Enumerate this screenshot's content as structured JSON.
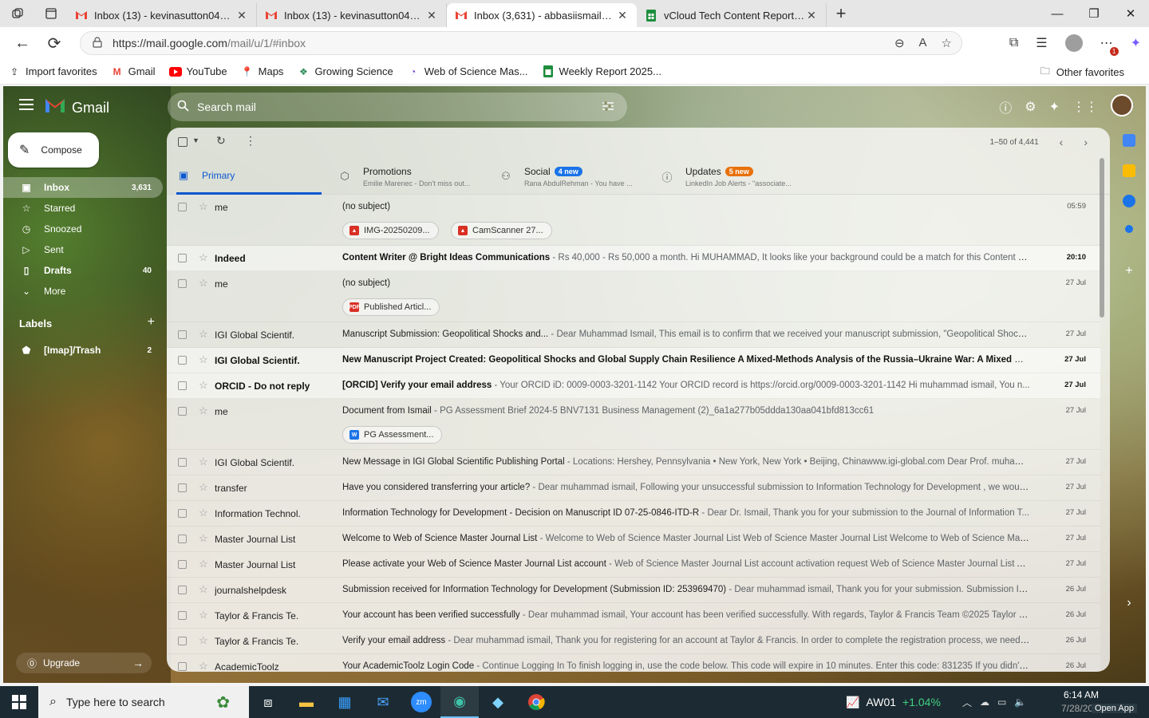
{
  "browser": {
    "tabs": [
      {
        "title": "Inbox (13) - kevinasutton04@gmail.com",
        "active": false
      },
      {
        "title": "Inbox (13) - kevinasutton04@gmail.com",
        "active": false
      },
      {
        "title": "Inbox (3,631) - abbasiismail08@gmail.com",
        "active": true
      },
      {
        "title": "vCloud Tech Content Report - Google Sheets",
        "active": false
      }
    ],
    "url_host": "https://mail.google.com",
    "url_path": "/mail/u/1/#inbox",
    "favorites": [
      {
        "label": "Import favorites",
        "icon": "import-icon"
      },
      {
        "label": "Gmail",
        "icon": "gmail-icon"
      },
      {
        "label": "YouTube",
        "icon": "youtube-icon"
      },
      {
        "label": "Maps",
        "icon": "maps-icon"
      },
      {
        "label": "Growing Science",
        "icon": "growing-science-icon"
      },
      {
        "label": "Web of Science Mas...",
        "icon": "wos-icon"
      },
      {
        "label": "Weekly Report 2025...",
        "icon": "sheets-icon"
      }
    ],
    "other_favorites": "Other favorites",
    "notification_count": "1"
  },
  "gmail": {
    "logo": "Gmail",
    "search_placeholder": "Search mail",
    "compose": "Compose",
    "nav": [
      {
        "label": "Inbox",
        "count": "3,631",
        "icon": "inbox-icon",
        "selected": true
      },
      {
        "label": "Starred",
        "count": "",
        "icon": "star-icon",
        "selected": false
      },
      {
        "label": "Snoozed",
        "count": "",
        "icon": "clock-icon",
        "selected": false
      },
      {
        "label": "Sent",
        "count": "",
        "icon": "send-icon",
        "selected": false
      },
      {
        "label": "Drafts",
        "count": "40",
        "icon": "draft-icon",
        "selected": false
      },
      {
        "label": "More",
        "count": "",
        "icon": "chevron-down-icon",
        "selected": false
      }
    ],
    "labels_title": "Labels",
    "labels": [
      {
        "label": "[Imap]/Trash",
        "count": "2"
      }
    ],
    "upgrade": "Upgrade",
    "pager": "1–50 of 4,441",
    "categories": [
      {
        "name": "Primary",
        "snippet": "",
        "badge": ""
      },
      {
        "name": "Promotions",
        "snippet": "Emilie Marenec - Don't miss out...",
        "badge": ""
      },
      {
        "name": "Social",
        "snippet": "Rana AbdulRehman - You have ...",
        "badge": "4 new"
      },
      {
        "name": "Updates",
        "snippet": "LinkedIn Job Alerts - \"associate...",
        "badge": "5 new"
      }
    ],
    "emails": [
      {
        "from": "me",
        "subject": "(no subject)",
        "snippet": "",
        "date": "05:59",
        "unread": false,
        "attachments": [
          {
            "name": "IMG-20250209...",
            "type": "img"
          },
          {
            "name": "CamScanner 27...",
            "type": "img"
          }
        ]
      },
      {
        "from": "Indeed",
        "subject": "Content Writer @ Bright Ideas Communications",
        "snippet": " - Rs 40,000 - Rs 50,000 a month. Hi MUHAMMAD, It looks like your background could be a match for this Content W...",
        "date": "20:10",
        "unread": true,
        "attachments": []
      },
      {
        "from": "me",
        "subject": "(no subject)",
        "snippet": "",
        "date": "27 Jul",
        "unread": false,
        "attachments": [
          {
            "name": "Published Articl...",
            "type": "pdf"
          }
        ]
      },
      {
        "from": "IGI Global Scientif.",
        "subject": "Manuscript Submission: Geopolitical Shocks and...",
        "snippet": " - Dear Muhammad Ismail, This email is to confirm that we received your manuscript submission, \"Geopolitical Shocks ...",
        "date": "27 Jul",
        "unread": false,
        "attachments": []
      },
      {
        "from": "IGI Global Scientif.",
        "subject": "New Manuscript Project Created: Geopolitical Shocks and Global Supply Chain Resilience A Mixed-Methods Analysis of the Russia–Ukraine War: A Mixed Me...",
        "snippet": "",
        "date": "27 Jul",
        "unread": true,
        "attachments": []
      },
      {
        "from": "ORCID - Do not reply",
        "subject": "[ORCID] Verify your email address",
        "snippet": " - Your ORCID iD: 0009-0003-3201-1142 Your ORCID record is https://orcid.org/0009-0003-3201-1142 Hi muhammad ismail, You n...",
        "date": "27 Jul",
        "unread": true,
        "attachments": []
      },
      {
        "from": "me",
        "subject": "Document from Ismail",
        "snippet": " - PG Assessment Brief 2024-5 BNV7131 Business Management (2)_6a1a277b05ddda130aa041bfd813cc61",
        "date": "27 Jul",
        "unread": false,
        "attachments": [
          {
            "name": "PG Assessment...",
            "type": "doc"
          }
        ]
      },
      {
        "from": "IGI Global Scientif.",
        "subject": "New Message in IGI Global Scientific Publishing Portal",
        "snippet": " - Locations: Hershey, Pennsylvania • New York, New York • Beijing, Chinawww.igi-global.com Dear Prof. muhamma...",
        "date": "27 Jul",
        "unread": false,
        "attachments": []
      },
      {
        "from": "transfer",
        "subject": "Have you considered transferring your article?",
        "snippet": " - Dear muhammad ismail, Following your unsuccessful submission to Information Technology for Development , we would ...",
        "date": "27 Jul",
        "unread": false,
        "attachments": []
      },
      {
        "from": "Information Technol.",
        "subject": "Information Technology for Development - Decision on Manuscript ID 07-25-0846-ITD-R",
        "snippet": " - Dear Dr. Ismail, Thank you for your submission to the Journal of Information T...",
        "date": "27 Jul",
        "unread": false,
        "attachments": []
      },
      {
        "from": "Master Journal List",
        "subject": "Welcome to Web of Science Master Journal List",
        "snippet": " - Welcome to Web of Science Master Journal List Web of Science Master Journal List Welcome to Web of Science Maste...",
        "date": "27 Jul",
        "unread": false,
        "attachments": []
      },
      {
        "from": "Master Journal List",
        "subject": "Please activate your Web of Science Master Journal List account",
        "snippet": " - Web of Science Master Journal List account activation request Web of Science Master Journal List Al...",
        "date": "27 Jul",
        "unread": false,
        "attachments": []
      },
      {
        "from": "journalshelpdesk",
        "subject": "Submission received for Information Technology for Development (Submission ID: 253969470)",
        "snippet": " - Dear muhammad ismail, Thank you for your submission. Submission ID 2...",
        "date": "26 Jul",
        "unread": false,
        "attachments": []
      },
      {
        "from": "Taylor & Francis Te.",
        "subject": "Your account has been verified successfully",
        "snippet": " - Dear muhammad ismail, Your account has been verified successfully. With regards, Taylor & Francis Team ©2025 Taylor & F...",
        "date": "26 Jul",
        "unread": false,
        "attachments": []
      },
      {
        "from": "Taylor & Francis Te.",
        "subject": "Verify your email address",
        "snippet": " - Dear muhammad ismail, Thank you for registering for an account at Taylor & Francis. In order to complete the registration process, we need y...",
        "date": "26 Jul",
        "unread": false,
        "attachments": []
      },
      {
        "from": "AcademicToolz",
        "subject": "Your AcademicToolz Login Code",
        "snippet": " - Continue Logging In To finish logging in, use the code below. This code will expire in 10 minutes. Enter this code: 831235 If you didn't tr...",
        "date": "26 Jul",
        "unread": false,
        "attachments": []
      }
    ]
  },
  "taskbar": {
    "search_placeholder": "Type here to search",
    "stock_name": "AW01",
    "stock_change": "+1.04%",
    "time": "6:14 AM",
    "date": "7/28/20",
    "open_app": "Open App"
  },
  "colors": {
    "accent": "#0b57d0",
    "social_badge": "#1a73e8",
    "updates_badge": "#e8710a",
    "gmail_red": "#ea4335"
  }
}
